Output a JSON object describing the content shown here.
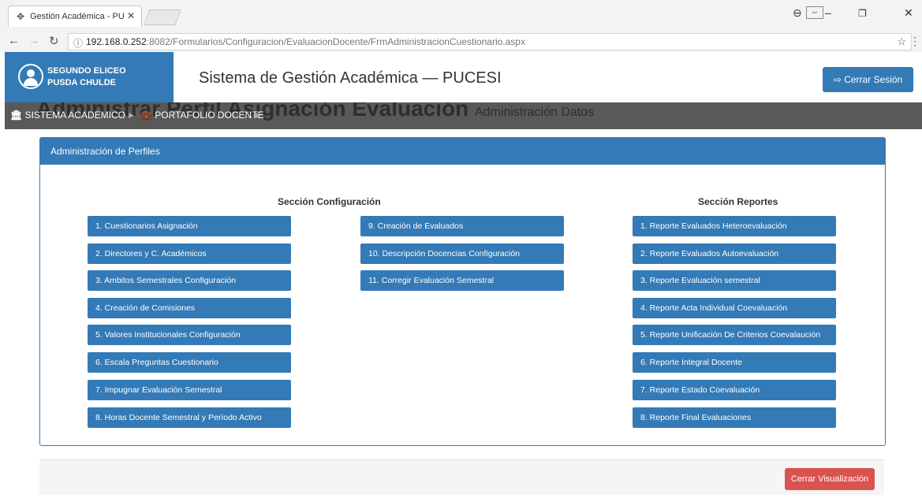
{
  "browser": {
    "tab_title": "Gestión Académica - PUC",
    "url_host": "192.168.0.252",
    "url_path": ":8082/Formularios/Configuracion/EvaluacionDocente/FrmAdministracionCuestionario.aspx"
  },
  "header": {
    "user_line1": "SEGUNDO ELICEO",
    "user_line2": "PUSDA CHULDE",
    "app_title": "Sistema de Gestión Académica — PUCESI",
    "logout_label": "Cerrar Sesión"
  },
  "breadcrumb": {
    "ghost_title": "Administrar Perfil Asignación Evaluación",
    "ghost_subtitle": "Administración Datos",
    "item1": "SISTEMA ACADEMICO",
    "item2": "PORTAFOLIO DOCENTE"
  },
  "panel": {
    "title": "Administración de Perfiles",
    "config_title": "Sección Configuración",
    "reports_title": "Sección Reportes",
    "config_col1": [
      "1. Cuestionarios Asignación",
      "2. Directores y C. Académicos",
      "3. Ambitos Semestrales Configuración",
      "4. Creación de Comisiones",
      "5. Valores Institucionales Configuración",
      "6. Escala Preguntas Cuestionario",
      "7. Impugnar Evaluación Semestral",
      "8. Horas Docente Semestral y Período Activo"
    ],
    "config_col2": [
      "9. Creación de Evaluados",
      "10. Descripción Docencias Configuración",
      "11. Corregir Evaluación Semestral"
    ],
    "reports": [
      "1. Reporte Evaluados Heteroevaluación",
      "2. Reporte Evaluados Autoevaluación",
      "3. Reporte Evaluación semestral",
      "4. Reporte Acta Individual Coevaluación",
      "5. Reporte Unificación De Criterios Coevalaución",
      "6. Reporte Integral Docente",
      "7. Reporte Estado Coevaluación",
      "8. Reporte Final Evaluaciones"
    ]
  },
  "footer": {
    "close_label": "Cerrar Visualización"
  },
  "colors": {
    "primary": "#337ab7",
    "danger": "#d9534f",
    "breadcrumb_bg": "#595959"
  }
}
